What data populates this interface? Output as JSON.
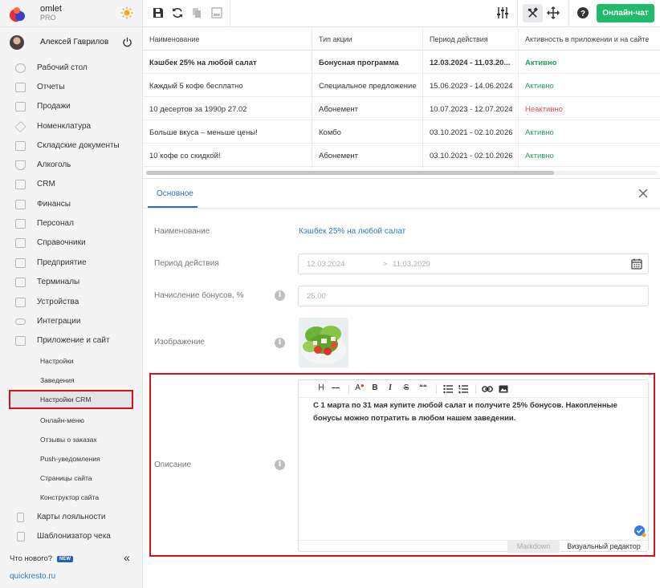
{
  "app": {
    "name": "omlet",
    "plan": "PRO"
  },
  "user": {
    "name": "Алексей Гаврилов"
  },
  "sidebar": {
    "items": [
      {
        "label": "Рабочий стол",
        "icon": "dashboard-icon"
      },
      {
        "label": "Отчеты",
        "icon": "reports-icon"
      },
      {
        "label": "Продажи",
        "icon": "cart-icon"
      },
      {
        "label": "Номенклатура",
        "icon": "tag-icon"
      },
      {
        "label": "Складские документы",
        "icon": "warehouse-icon"
      },
      {
        "label": "Алкоголь",
        "icon": "glass-icon"
      },
      {
        "label": "CRM",
        "icon": "crm-icon"
      },
      {
        "label": "Финансы",
        "icon": "wallet-icon"
      },
      {
        "label": "Персонал",
        "icon": "people-icon"
      },
      {
        "label": "Справочники",
        "icon": "book-icon"
      },
      {
        "label": "Предприятие",
        "icon": "building-icon"
      },
      {
        "label": "Терминалы",
        "icon": "terminal-icon"
      },
      {
        "label": "Устройства",
        "icon": "printer-icon"
      },
      {
        "label": "Интеграции",
        "icon": "link-icon"
      },
      {
        "label": "Приложение и сайт",
        "icon": "app-icon"
      }
    ],
    "subitems": [
      {
        "label": "Настройки"
      },
      {
        "label": "Заведения"
      },
      {
        "label": "Настройки CRM"
      },
      {
        "label": "Онлайн-меню"
      },
      {
        "label": "Отзывы о заказах"
      },
      {
        "label": "Push-уведомления"
      },
      {
        "label": "Страницы сайта"
      },
      {
        "label": "Конструктор сайта"
      }
    ],
    "bottom_items": [
      {
        "label": "Карты лояльности",
        "icon": "card-icon"
      },
      {
        "label": "Шаблонизатор чека",
        "icon": "receipt-icon"
      }
    ],
    "whats_new": "Что нового?",
    "new_badge": "NEW",
    "site_link": "quickresto.ru"
  },
  "toolbar": {
    "online_chat": "Онлайн-чат"
  },
  "table": {
    "columns": [
      "Наименование",
      "Тип акции",
      "Период действия",
      "Активность в приложении и на сайте"
    ],
    "rows": [
      [
        "Кэшбек 25% на любой салат",
        "Бонусная программа",
        "12.03.2024 - 11.03.20...",
        "Активно"
      ],
      [
        "Каждый 5 кофе бесплатно",
        "Специальное предложение",
        "15.06.2023 - 14.06.2024",
        "Активно"
      ],
      [
        "10 десертов за 1990р 27.02",
        "Абонемент",
        "10.07.2023 - 12.07.2024",
        "Неактивно"
      ],
      [
        "Больше вкуса – меньше цены!",
        "Комбо",
        "03.10.2021 - 02.10.2026",
        "Активно"
      ],
      [
        "10 кофе со скидкой!",
        "Абонемент",
        "03.10.2021 - 02.10.2026",
        "Активно"
      ]
    ]
  },
  "colors": {
    "accent": "#1fba6a",
    "active": "#21a45c",
    "inactive": "#e14b4b",
    "link": "#2f78c4",
    "highlight": "#d8121b"
  },
  "form": {
    "tab": "Основное",
    "name_label": "Наименование",
    "name_value": "Кэшбек 25% на любой салат",
    "period_label": "Период действия",
    "period_from": "12.03.2024",
    "period_arrow": ">",
    "period_to": "11.03.2029",
    "bonus_label": "Начисление бонусов, %",
    "bonus_value": "25,00",
    "image_label": "Изображение",
    "description_label": "Описание",
    "description_text": "С 1 марта по 31 мая купите любой салат и получите 25% бонусов. Накопленные бонусы можно потратить в любом нашем заведении.",
    "info_glyph": "i"
  },
  "editor": {
    "buttons": [
      "H",
      "—",
      "A",
      "B",
      "I",
      "S",
      "❝❝"
    ],
    "mode_markdown": "Markdown",
    "mode_visual": "Визуальный редактор"
  }
}
